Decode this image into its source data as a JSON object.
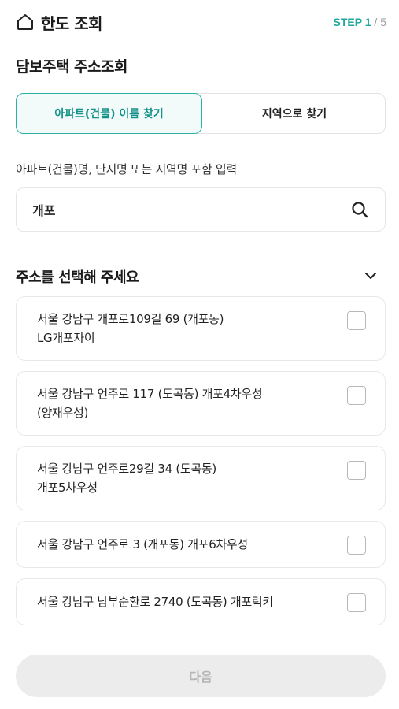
{
  "header": {
    "title": "한도 조회",
    "step_label": "STEP 1",
    "step_total": " / 5"
  },
  "section": {
    "title": "담보주택 주소조회"
  },
  "tabs": [
    {
      "label": "아파트(건물) 이름 찾기",
      "active": true
    },
    {
      "label": "지역으로 찾기",
      "active": false
    }
  ],
  "search": {
    "label": "아파트(건물)명, 단지명 또는 지역명 포함 입력",
    "value": "개포",
    "placeholder": ""
  },
  "address_list": {
    "title": "주소를 선택해 주세요",
    "items": [
      {
        "line1": "서울 강남구 개포로109길 69 (개포동)",
        "line2": "LG개포자이",
        "checked": false
      },
      {
        "line1": "서울 강남구 언주로 117 (도곡동) 개포4차우성",
        "line2": "(양재우성)",
        "checked": false
      },
      {
        "line1": "서울 강남구 언주로29길 34 (도곡동)",
        "line2": "개포5차우성",
        "checked": false
      },
      {
        "line1": "서울 강남구 언주로 3 (개포동) 개포6차우성",
        "line2": "",
        "checked": false
      },
      {
        "line1": "서울 강남구 남부순환로 2740 (도곡동) 개포럭키",
        "line2": "",
        "checked": false
      }
    ]
  },
  "footer": {
    "next_label": "다음",
    "disabled": true
  },
  "colors": {
    "accent": "#2bb0a5",
    "accent_text": "#15928a",
    "disabled_bg": "#ececec"
  },
  "icons": [
    "home-icon",
    "search-icon",
    "chevron-down-icon"
  ]
}
